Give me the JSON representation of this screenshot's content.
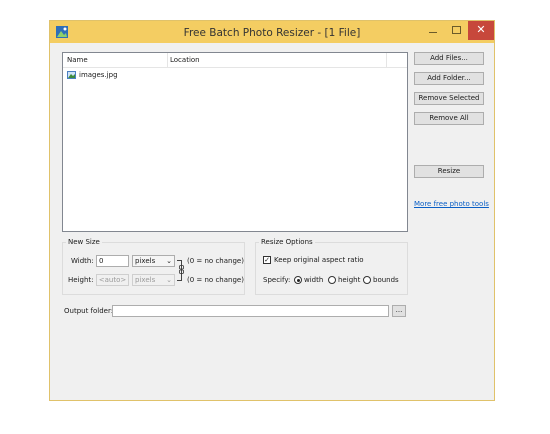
{
  "window": {
    "title": "Free Batch Photo Resizer - [1 File]",
    "controls": {
      "minimize": "",
      "maximize": "",
      "close": "✕"
    }
  },
  "file_list": {
    "columns": [
      "Name",
      "Location"
    ],
    "rows": [
      {
        "name": "images.jpg",
        "location": ""
      }
    ]
  },
  "buttons": {
    "add_files": "Add Files...",
    "add_folder": "Add Folder...",
    "remove_selected": "Remove Selected",
    "remove_all": "Remove All",
    "resize": "Resize"
  },
  "links": {
    "more_tools": "More free photo tools"
  },
  "new_size": {
    "title": "New Size",
    "width_label": "Width:",
    "width_value": "0",
    "width_unit": "pixels",
    "width_hint": "(0 = no change)",
    "height_label": "Height:",
    "height_value": "<auto>",
    "height_unit": "pixels",
    "height_hint": "(0 = no change)"
  },
  "resize_options": {
    "title": "Resize Options",
    "keep_aspect_label": "Keep original aspect ratio",
    "keep_aspect_checked": true,
    "specify_label": "Specify:",
    "options": [
      "width",
      "height",
      "bounds"
    ],
    "selected": "width"
  },
  "output": {
    "label": "Output folder:",
    "value": "",
    "browse_label": "..."
  }
}
